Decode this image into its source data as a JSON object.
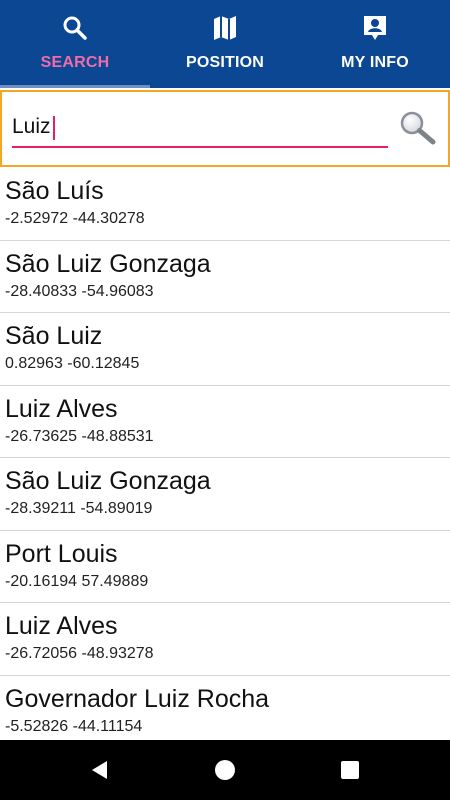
{
  "tabs": [
    {
      "label": "SEARCH",
      "icon": "search-icon",
      "active": true
    },
    {
      "label": "POSITION",
      "icon": "map-icon",
      "active": false
    },
    {
      "label": "MY INFO",
      "icon": "contact-card-icon",
      "active": false
    }
  ],
  "search": {
    "value": "Luiz",
    "button_icon": "magnifier-icon"
  },
  "results": [
    {
      "name": "São Luís",
      "coords": "-2.52972 -44.30278"
    },
    {
      "name": "São Luiz Gonzaga",
      "coords": "-28.40833 -54.96083"
    },
    {
      "name": "São Luiz",
      "coords": "0.82963 -60.12845"
    },
    {
      "name": "Luiz Alves",
      "coords": "-26.73625 -48.88531"
    },
    {
      "name": "São Luiz Gonzaga",
      "coords": "-28.39211 -54.89019"
    },
    {
      "name": "Port Louis",
      "coords": "-20.16194 57.49889"
    },
    {
      "name": "Luiz Alves",
      "coords": "-26.72056 -48.93278"
    },
    {
      "name": "Governador Luiz Rocha",
      "coords": "-5.52826 -44.11154"
    }
  ],
  "colors": {
    "tabbar": "#0b4793",
    "active_tab": "#f06ba8",
    "focus_border": "#f5a623",
    "input_underline": "#e91e63"
  },
  "navbar": {
    "back_icon": "back-triangle-icon",
    "home_icon": "home-circle-icon",
    "recents_icon": "recents-square-icon"
  }
}
